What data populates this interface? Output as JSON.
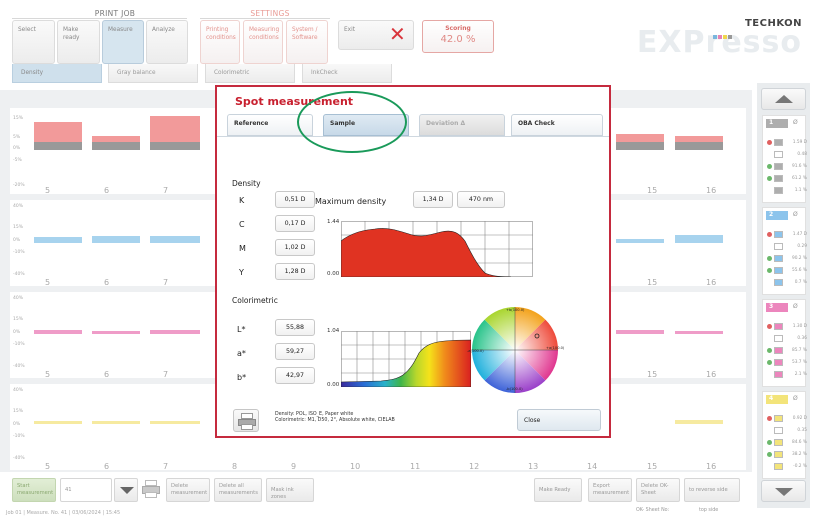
{
  "header": {
    "print_job_title": "PRINT JOB",
    "settings_title": "SETTINGS",
    "buttons": {
      "select": "Select",
      "make_ready": "Make ready",
      "measure": "Measure",
      "analyze": "Analyze",
      "printing_conditions": "Printing conditions",
      "measuring_conditions": "Measuring conditions",
      "system_software": "System / Software",
      "exit": "Exit"
    },
    "scoring_label": "Scoring",
    "scoring_value": "42.0 %",
    "logo_top": "TECHKON",
    "logo_bottom": "EXPresso"
  },
  "subtabs": [
    "Density",
    "Gray balance",
    "Colorimetric",
    "InkCheck"
  ],
  "chart": {
    "cell_numbers": [
      "5",
      "6",
      "7",
      "8",
      "9",
      "10",
      "11",
      "12",
      "13",
      "14",
      "15",
      "16"
    ],
    "axis_labels": {
      "black": [
        "15%",
        "5%",
        "0%",
        "-5%",
        "-20%"
      ],
      "cyan": [
        "40%",
        "15%",
        "0%",
        "-10%",
        "-40%"
      ],
      "magenta": [
        "40%",
        "15%",
        "0%",
        "-10%",
        "-40%"
      ],
      "yellow": [
        "40%",
        "15%",
        "0%",
        "-10%",
        "-40%"
      ]
    },
    "colors": {
      "black": "#f29a9a",
      "cyan": "#a7d3ee",
      "magenta": "#ef9cc8",
      "yellow": "#f6eaa0"
    }
  },
  "side_cards": [
    {
      "num": "1",
      "sym": "Ø",
      "color": "#aeaeae",
      "rows": [
        "1.59 D",
        "0.48",
        "91.6 %",
        "61.2 %",
        "1.1 %"
      ]
    },
    {
      "num": "2",
      "sym": "Ø",
      "color": "#8cc4ec",
      "rows": [
        "1.47 D",
        "0.29",
        "90.2 %",
        "55.6 %",
        "0.7 %"
      ]
    },
    {
      "num": "3",
      "sym": "Ø",
      "color": "#ec86bd",
      "rows": [
        "1.30 D",
        "0.36",
        "85.7 %",
        "53.7 %",
        "2.1 %"
      ]
    },
    {
      "num": "4",
      "sym": "Ø",
      "color": "#f3e47a",
      "rows": [
        "0.92 D",
        "0.35",
        "84.6 %",
        "38.2 %",
        "-0.2 %"
      ]
    }
  ],
  "bottom": {
    "start_measurement": "Start measurement",
    "sheet_number": "41",
    "delete_measurement": "Delete measurement",
    "delete_all": "Delete all measurements",
    "mask_ink_zones": "Mask ink zones",
    "make_ready": "Make Ready",
    "export_measurement": "Export measurement",
    "delete_ok_sheet": "Delete OK-Sheet",
    "reverse_side": "to reverse side",
    "ok_sheet_no": "OK- Sheet No:",
    "top_side": "top side"
  },
  "status_text": "Job 01 | Measure. No. 41 | 03/06/2024 | 15:45",
  "modal": {
    "title": "Spot measurement",
    "tabs": [
      "Reference",
      "Sample",
      "Deviation Δ",
      "OBA Check"
    ],
    "density_title": "Density",
    "density_rows": [
      {
        "label": "K",
        "value": "0,51 D"
      },
      {
        "label": "C",
        "value": "0,17 D"
      },
      {
        "label": "M",
        "value": "1,02 D"
      },
      {
        "label": "Y",
        "value": "1,28 D"
      }
    ],
    "max_density_label": "Maximum density",
    "max_density_value": "1,34 D",
    "max_density_wavelength": "470 nm",
    "density_chart_y": [
      "1.44",
      "0.00"
    ],
    "colorimetric_title": "Colorimetric",
    "lab_rows": [
      {
        "label": "L*",
        "value": "55,88"
      },
      {
        "label": "a*",
        "value": "59,27"
      },
      {
        "label": "b*",
        "value": "42,97"
      }
    ],
    "spectral_chart_y": [
      "1.04",
      "0.00"
    ],
    "wheel_labels": {
      "top": "+b(100.0)",
      "bottom": "-b(100.0)",
      "left": "-a(100.0)",
      "right": "+a(100.0)"
    },
    "note_line1": "Density: POL, ISO_E, Paper white",
    "note_line2": "Colorimetric: M1, D50, 2°, Absolute white, CIELAB",
    "close_label": "Close"
  }
}
